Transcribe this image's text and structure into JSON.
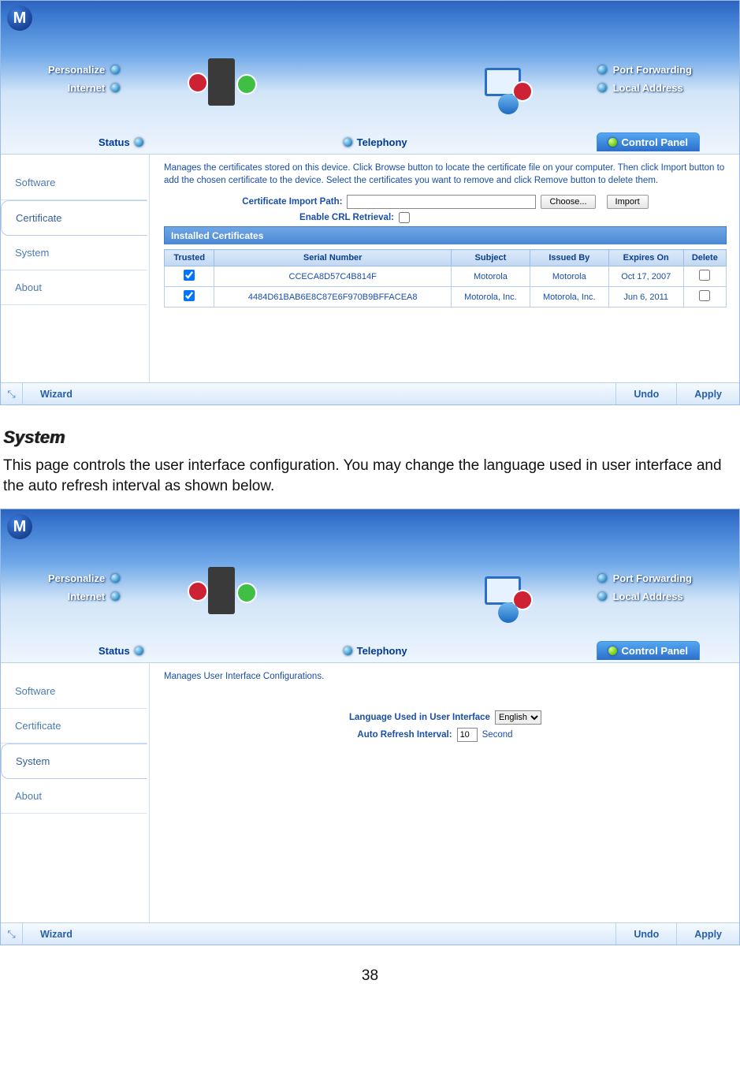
{
  "doc": {
    "section_heading": "System",
    "section_body": "This page controls the user interface configuration. You may change the language used in user interface and the auto refresh interval as shown below.",
    "page_number": "38"
  },
  "common": {
    "logo_glyph": "M",
    "nav_left": {
      "personalize": "Personalize",
      "internet": "Internet"
    },
    "nav_right": {
      "port_forwarding": "Port Forwarding",
      "local_address": "Local Address"
    },
    "tabs": {
      "status": "Status",
      "telephony": "Telephony",
      "control_panel": "Control Panel"
    },
    "sidebar": {
      "software": "Software",
      "certificate": "Certificate",
      "system": "System",
      "about": "About"
    },
    "footer": {
      "wizard": "Wizard",
      "undo": "Undo",
      "apply": "Apply"
    }
  },
  "cert_panel": {
    "intro": "Manages the certificates stored on this device. Click Browse button to locate the certificate file on your computer. Then click Import button to add the chosen certificate to the device. Select the certificates you want to remove and click Remove button to delete them.",
    "import_path_label": "Certificate Import Path:",
    "choose": "Choose...",
    "import": "Import",
    "crl_label": "Enable CRL Retrieval:",
    "table_title": "Installed Certificates",
    "headers": {
      "trusted": "Trusted",
      "serial": "Serial Number",
      "subject": "Subject",
      "issued": "Issued By",
      "expires": "Expires On",
      "delete": "Delete"
    },
    "rows": [
      {
        "serial": "CCECA8D57C4B814F",
        "subject": "Motorola",
        "issued": "Motorola",
        "expires": "Oct 17, 2007"
      },
      {
        "serial": "4484D61BAB6E8C87E6F970B9BFFACEA8",
        "subject": "Motorola, Inc.",
        "issued": "Motorola, Inc.",
        "expires": "Jun 6, 2011"
      }
    ]
  },
  "system_panel": {
    "intro": "Manages User Interface Configurations.",
    "lang_label": "Language Used in User Interface",
    "lang_value": "English",
    "refresh_label": "Auto Refresh Interval:",
    "refresh_value": "10",
    "refresh_unit": "Second"
  }
}
